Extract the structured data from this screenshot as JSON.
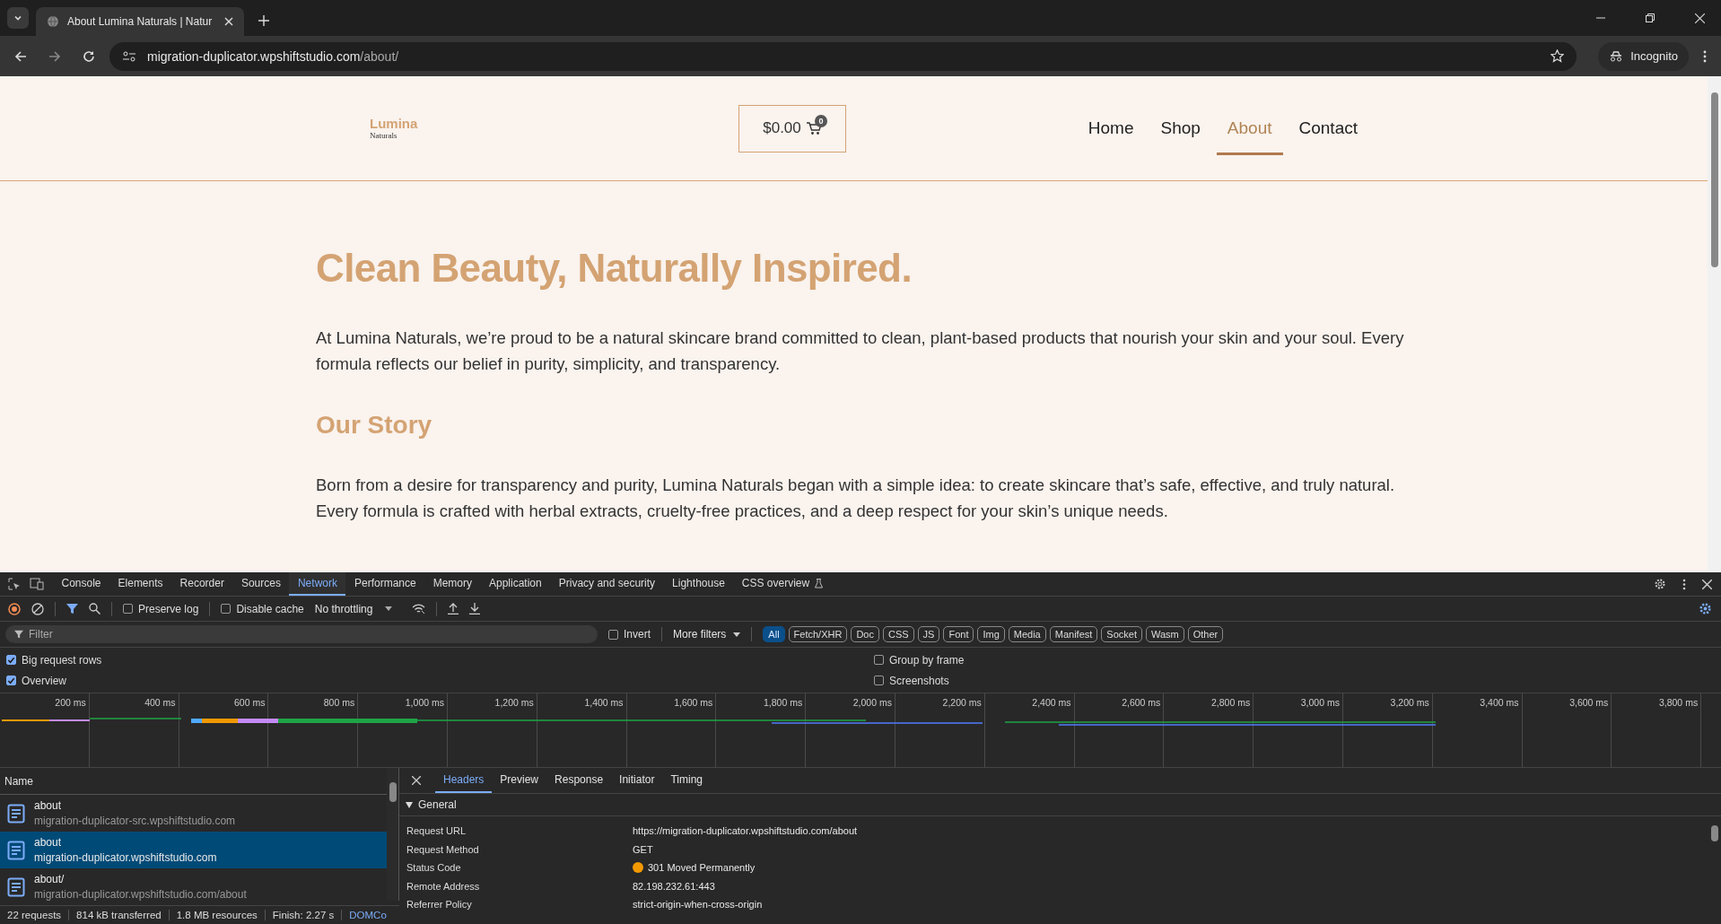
{
  "browser": {
    "tab_title": "About Lumina Naturals | Natur",
    "address_host": "migration-duplicator.wpshiftstudio.com",
    "address_path": "/about/",
    "incognito_label": "Incognito"
  },
  "site": {
    "logo": {
      "name": "Lumina",
      "tagline": "Naturals"
    },
    "cart": {
      "amount": "$0.00",
      "count": "0"
    },
    "nav": [
      {
        "label": "Home",
        "selected": false
      },
      {
        "label": "Shop",
        "selected": false
      },
      {
        "label": "About",
        "selected": true
      },
      {
        "label": "Contact",
        "selected": false
      }
    ],
    "heading": "Clean Beauty, Naturally Inspired.",
    "intro": "At Lumina Naturals, we’re proud to be a natural skincare brand committed to clean, plant-based products that nourish your skin and your soul. Every formula reflects our belief in purity, simplicity, and transparency.",
    "sections": [
      {
        "heading": "Our Story",
        "body": "Born from a desire for transparency and purity, Lumina Naturals began with a simple idea: to create skincare that’s safe, effective, and truly natural. Every formula is crafted with herbal extracts, cruelty-free practices, and a deep respect for your skin’s unique needs."
      }
    ]
  },
  "devtools": {
    "tabs": [
      {
        "label": "Console",
        "selected": false
      },
      {
        "label": "Elements",
        "selected": false
      },
      {
        "label": "Recorder",
        "selected": false
      },
      {
        "label": "Sources",
        "selected": false
      },
      {
        "label": "Network",
        "selected": true
      },
      {
        "label": "Performance",
        "selected": false
      },
      {
        "label": "Memory",
        "selected": false
      },
      {
        "label": "Application",
        "selected": false
      },
      {
        "label": "Privacy and security",
        "selected": false
      },
      {
        "label": "Lighthouse",
        "selected": false
      },
      {
        "label": "CSS overview",
        "selected": false
      }
    ],
    "toolbar": {
      "preserve_log": {
        "label": "Preserve log",
        "checked": false
      },
      "disable_cache": {
        "label": "Disable cache",
        "checked": false
      },
      "throttling": "No throttling"
    },
    "filter": {
      "placeholder": "Filter",
      "invert": {
        "label": "Invert",
        "checked": false
      },
      "more_filters": "More filters",
      "types": [
        {
          "label": "All",
          "selected": true
        },
        {
          "label": "Fetch/XHR",
          "selected": false
        },
        {
          "label": "Doc",
          "selected": false
        },
        {
          "label": "CSS",
          "selected": false
        },
        {
          "label": "JS",
          "selected": false
        },
        {
          "label": "Font",
          "selected": false
        },
        {
          "label": "Img",
          "selected": false
        },
        {
          "label": "Media",
          "selected": false
        },
        {
          "label": "Manifest",
          "selected": false
        },
        {
          "label": "Socket",
          "selected": false
        },
        {
          "label": "Wasm",
          "selected": false
        },
        {
          "label": "Other",
          "selected": false
        }
      ]
    },
    "options": [
      {
        "label": "Big request rows",
        "checked": true
      },
      {
        "label": "Group by frame",
        "checked": false
      },
      {
        "label": "Overview",
        "checked": true
      },
      {
        "label": "Screenshots",
        "checked": false
      }
    ],
    "timeline": {
      "ticks": [
        "200 ms",
        "400 ms",
        "600 ms",
        "800 ms",
        "1,000 ms",
        "1,200 ms",
        "1,400 ms",
        "1,600 ms",
        "1,800 ms",
        "2,000 ms",
        "2,200 ms",
        "2,400 ms",
        "2,600 ms",
        "2,800 ms",
        "3,000 ms",
        "3,200 ms",
        "3,400 ms",
        "3,600 ms",
        "3,800 ms"
      ]
    },
    "requests": {
      "column": "Name",
      "rows": [
        {
          "name": "about",
          "domain": "migration-duplicator-src.wpshiftstudio.com",
          "selected": false
        },
        {
          "name": "about",
          "domain": "migration-duplicator.wpshiftstudio.com",
          "selected": true
        },
        {
          "name": "about/",
          "domain": "migration-duplicator.wpshiftstudio.com/about",
          "selected": false
        }
      ]
    },
    "detail": {
      "tabs": [
        {
          "label": "Headers",
          "selected": true
        },
        {
          "label": "Preview",
          "selected": false
        },
        {
          "label": "Response",
          "selected": false
        },
        {
          "label": "Initiator",
          "selected": false
        },
        {
          "label": "Timing",
          "selected": false
        }
      ],
      "section": {
        "title": "General",
        "expanded": true,
        "rows": [
          {
            "key": "Request URL",
            "value": "https://migration-duplicator.wpshiftstudio.com/about"
          },
          {
            "key": "Request Method",
            "value": "GET"
          },
          {
            "key": "Status Code",
            "value": "301 Moved Permanently",
            "color": "#f29900"
          },
          {
            "key": "Remote Address",
            "value": "82.198.232.61:443"
          },
          {
            "key": "Referrer Policy",
            "value": "strict-origin-when-cross-origin"
          }
        ]
      }
    },
    "status_bar": [
      "22 requests",
      "814 kB transferred",
      "1.8 MB resources",
      "Finish: 2.27 s",
      "DOMCo"
    ]
  }
}
